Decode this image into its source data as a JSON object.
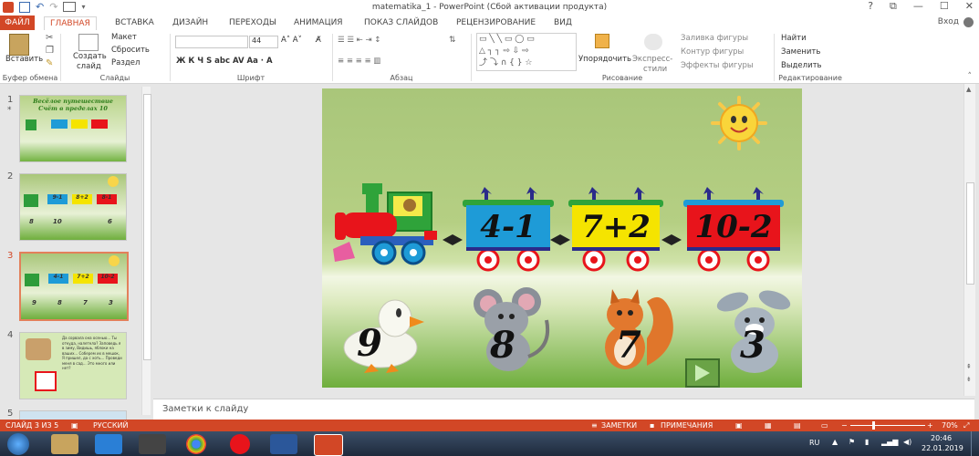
{
  "window": {
    "title": "matematika_1 -  PowerPoint (Сбой активации продукта)",
    "controls": [
      "?",
      "⧉",
      "—",
      "☐",
      "✕"
    ]
  },
  "tabs": {
    "file": "ФАЙЛ",
    "items": [
      "ГЛАВНАЯ",
      "ВСТАВКА",
      "ДИЗАЙН",
      "ПЕРЕХОДЫ",
      "АНИМАЦИЯ",
      "ПОКАЗ СЛАЙДОВ",
      "РЕЦЕНЗИРОВАНИЕ",
      "ВИД"
    ],
    "active": "ГЛАВНАЯ",
    "login": "Вход"
  },
  "ribbon": {
    "paste": "Вставить",
    "create_slide_1": "Создать",
    "create_slide_2": "слайд",
    "layout": "Макет",
    "reset": "Сбросить",
    "section": "Раздел",
    "font_size": "44",
    "shape_fill": "Заливка фигуры",
    "shape_outline": "Контур фигуры",
    "shape_effects": "Эффекты фигуры",
    "arrange": "Упорядочить",
    "quick_styles_1": "Экспресс-",
    "quick_styles_2": "стили",
    "find": "Найти",
    "replace": "Заменить",
    "select": "Выделить",
    "groups": [
      "Буфер обмена",
      "Слайды",
      "Шрифт",
      "Абзац",
      "Рисование",
      "Редактирование"
    ]
  },
  "thumbnails": [
    {
      "num": "1",
      "title_1": "Весёлое путешествие",
      "title_2": "Счёт в пределах 10"
    },
    {
      "num": "2",
      "ops": [
        "9-1",
        "8+2",
        "8-1"
      ],
      "nums": [
        "8",
        "10",
        "6"
      ]
    },
    {
      "num": "3",
      "ops": [
        "4-1",
        "7+2",
        "10-2"
      ],
      "nums": [
        "9",
        "8",
        "7",
        "3"
      ]
    },
    {
      "num": "4",
      "text": "Да сорвала она осенью... Ты откуда, налетела? Заповедь я в зиму, Видишь, яблоки на ваших... Соберем их в мешок, Я пришел, да с хоть... Проведи меня в сад... Это много или нет?"
    },
    {
      "num": "5"
    }
  ],
  "slide": {
    "wagons": [
      {
        "expr": "4-1",
        "color": "#1e9bd7"
      },
      {
        "expr": "7+2",
        "color": "#f5e400"
      },
      {
        "expr": "10-2",
        "color": "#e8141b"
      }
    ],
    "animals": [
      {
        "name": "duck",
        "number": "9"
      },
      {
        "name": "mouse",
        "number": "8"
      },
      {
        "name": "squirrel",
        "number": "7"
      },
      {
        "name": "hare",
        "number": "3"
      }
    ]
  },
  "notes_placeholder": "Заметки к слайду",
  "status": {
    "slide_info": "СЛАЙД 3 ИЗ 5",
    "language": "РУССКИЙ",
    "notes": "ЗАМЕТКИ",
    "comments": "ПРИМЕЧАНИЯ",
    "zoom": "70%"
  },
  "tray": {
    "lang": "RU",
    "time": "20:46",
    "date": "22.01.2019"
  },
  "colors": {
    "accent": "#d24726",
    "taskbar": "#2b3a52"
  }
}
